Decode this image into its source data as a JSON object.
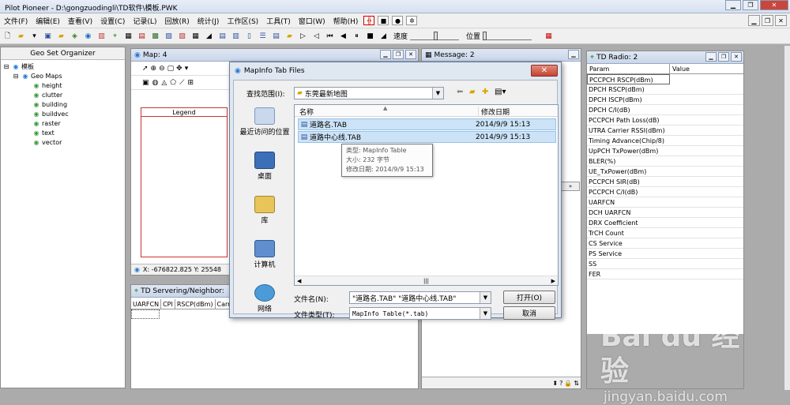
{
  "app": {
    "title": "Pilot Pioneer - D:\\gongzuodingli\\TD软件\\模板.PWK"
  },
  "menu": [
    "文件(F)",
    "编辑(E)",
    "查看(V)",
    "设置(C)",
    "记录(L)",
    "回放(R)",
    "统计(J)",
    "工作区(S)",
    "工具(T)",
    "窗口(W)",
    "帮助(H)"
  ],
  "toolbar": {
    "speed_label": "速度",
    "position_label": "位置"
  },
  "geo_panel": {
    "title": "Geo Set Organizer",
    "root": "模板",
    "group": "Geo Maps",
    "layers": [
      "height",
      "clutter",
      "building",
      "buildvec",
      "raster",
      "text",
      "vector"
    ]
  },
  "map_panel": {
    "title": "Map: 4",
    "legend": "Legend",
    "coords": "X: -676822.825 Y: 25548"
  },
  "message_panel": {
    "title": "Message: 2"
  },
  "servering_panel": {
    "title": "TD Servering/Neighbor:",
    "columns": [
      "UARFCN",
      "CPI",
      "RSCP(dBm)",
      "Carrie"
    ]
  },
  "radio_panel": {
    "title": "TD Radio: 2",
    "columns": [
      "Param",
      "Value"
    ],
    "params": [
      "PCCPCH RSCP(dBm)",
      "DPCH RSCP(dBm)",
      "DPCH ISCP(dBm)",
      "DPCH C/I(dB)",
      "PCCPCH Path Loss(dB)",
      "UTRA Carrier RSSI(dBm)",
      "Timing Advance(Chip/8)",
      "UpPCH TxPower(dBm)",
      "BLER(%)",
      "UE_TxPower(dBm)",
      "PCCPCH SIR(dB)",
      "PCCPCH C/I(dB)",
      "UARFCN",
      "DCH UARFCN",
      "DRX Coefficient",
      "TrCH Count",
      "CS Service",
      "PS Service",
      "SS",
      "FER"
    ]
  },
  "dialog": {
    "title": "MapInfo Tab Files",
    "look_in_label": "查找范围(I):",
    "look_in_value": "东莞最新地图",
    "places": [
      "最近访问的位置",
      "桌面",
      "库",
      "计算机",
      "网络"
    ],
    "columns": {
      "name": "名称",
      "date": "修改日期"
    },
    "files": [
      {
        "name": "道路名.TAB",
        "date": "2014/9/9 15:13"
      },
      {
        "name": "道路中心线.TAB",
        "date": "2014/9/9 15:13"
      }
    ],
    "tooltip": {
      "type": "类型: MapInfo Table",
      "size": "大小: 232 字节",
      "modified": "修改日期: 2014/9/9 15:13"
    },
    "filename_label": "文件名(N):",
    "filename_value": "\"道路名.TAB\" \"道路中心线.TAB\"",
    "filetype_label": "文件类型(T):",
    "filetype_value": "MapInfo Table(*.tab)",
    "open_label": "打开(O)",
    "cancel_label": "取消"
  },
  "watermark": {
    "brand": "Bai du 经验",
    "url": "jingyan.baidu.com"
  }
}
